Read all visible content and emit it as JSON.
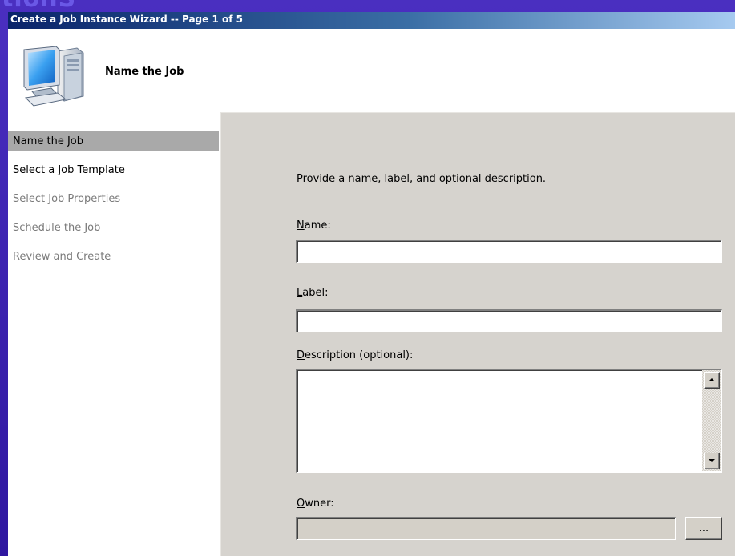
{
  "background": {
    "text": "tionS",
    "color": "#3a1fa8"
  },
  "window": {
    "title": "Create a Job Instance Wizard -- Page 1 of 5",
    "title_bar_color": "#0a246a"
  },
  "header": {
    "icon": "computer-icon",
    "title": "Name the Job"
  },
  "sidebar": {
    "active_color": "#a9a9a9",
    "items": [
      {
        "label": "Name the Job",
        "state": "active"
      },
      {
        "label": "Select a Job Template",
        "state": "enabled"
      },
      {
        "label": "Select Job Properties",
        "state": "disabled"
      },
      {
        "label": "Schedule the Job",
        "state": "disabled"
      },
      {
        "label": "Review and Create",
        "state": "disabled"
      }
    ]
  },
  "form": {
    "instructions": "Provide a name, label, and optional description.",
    "name": {
      "mnemonic": "N",
      "label_rest": "ame:",
      "value": ""
    },
    "label": {
      "mnemonic": "L",
      "label_rest": "abel:",
      "value": ""
    },
    "description": {
      "mnemonic": "D",
      "label_rest": "escription (optional):",
      "value": ""
    },
    "owner": {
      "mnemonic": "O",
      "label_rest": "wner:",
      "value": ""
    },
    "browse_button_label": "...",
    "panel_color": "#d6d3ce"
  }
}
